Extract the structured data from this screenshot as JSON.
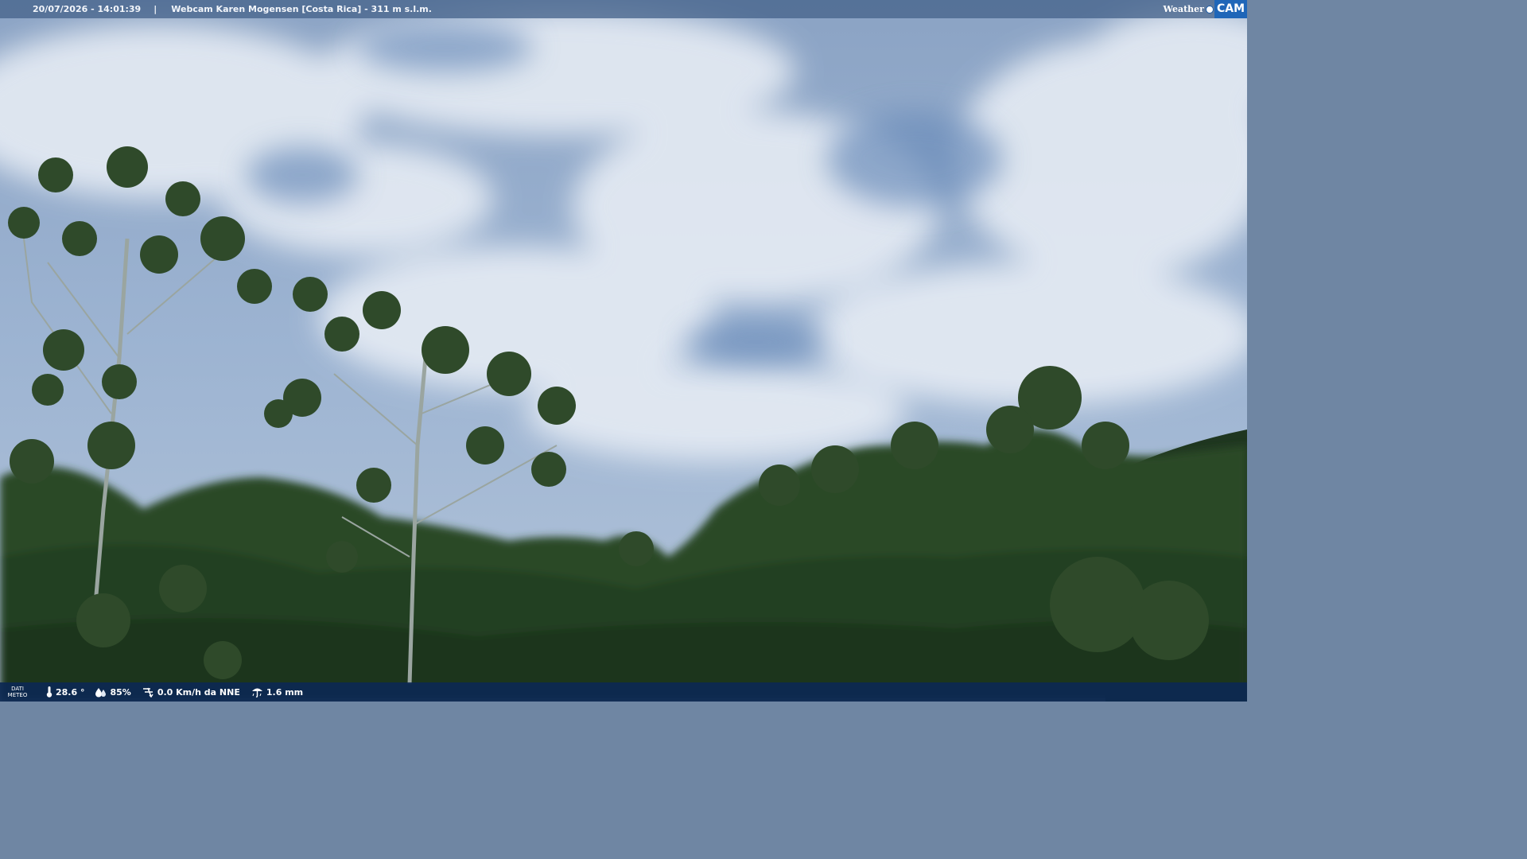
{
  "header": {
    "datetime": "20/07/2026 - 14:01:39",
    "separator": "|",
    "title": "Webcam Karen Mogensen [Costa Rica] - 311 m s.l.m."
  },
  "brand": {
    "weather": "Weather",
    "cam": "CAM"
  },
  "footer": {
    "dati_line1": "DATI",
    "dati_line2": "METEO",
    "temperature": "28.6 °",
    "humidity": "85%",
    "wind": "0.0 Km/h da NNE",
    "rain": "1.6 mm"
  },
  "icons": [
    "thermometer-icon",
    "humidity-icon",
    "wind-icon",
    "rain-icon"
  ],
  "colors": {
    "sky": "#8aa6c9",
    "cloud": "#e4ebf3",
    "foliage": "#2e4d27",
    "header_bg": "#46648c",
    "footer_bg": "#0c2852",
    "brand_blue": "#1f66b8"
  }
}
